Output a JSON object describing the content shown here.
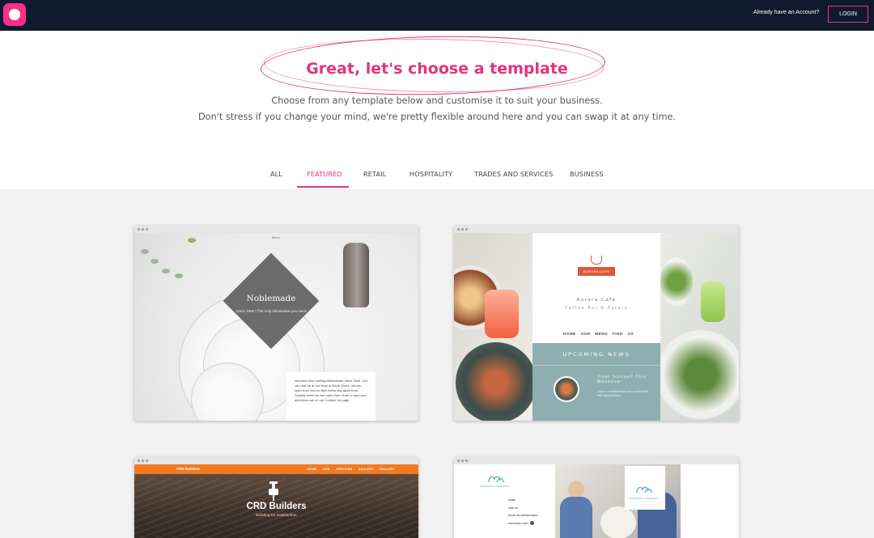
{
  "header": {
    "have_account": "Already have an Account?",
    "login_label": "LOGIN",
    "brand_color": "#ff2d8a",
    "bar_color": "#0f1a2e"
  },
  "hero": {
    "title": "Great, let's choose a template",
    "subtitle_1": "Choose from any template below and customise it to suit your business.",
    "subtitle_2": "Don't stress if you change your mind, we're pretty flexible around here and you can swap it at any time.",
    "accent_color": "#e4327f"
  },
  "tabs": [
    {
      "label": "ALL",
      "active": false
    },
    {
      "label": "FEATURED",
      "active": true
    },
    {
      "label": "RETAIL",
      "active": false
    },
    {
      "label": "HOSPITALITY",
      "active": false
    },
    {
      "label": "TRADES AND SERVICES",
      "active": false
    },
    {
      "label": "BUSINESS",
      "active": false
    }
  ],
  "templates": {
    "noblemade": {
      "top_note": "Menu",
      "brand": "Noblemade",
      "brand_sub": "Since 1965 | The only dinnerware you need",
      "about": "We have been selling kitchenware since 1965. You can visit us at our shop in North Shore, we are open from 9am to 5pm every day apart from Sunday when we are open from 11am to 4pm and directions are on our Contact Us page."
    },
    "aurora": {
      "ribbon": "AURORA CAFE",
      "name": "Aurora Cafe",
      "tagline": "Coffee Bar & Eatery",
      "nav": "HOME  OUR MENU  FIND US",
      "news_title": "UPCOMING NEWS",
      "news_heading": "Treat Yourself This Weekend!",
      "news_body": "Enjoy a complimentary hot or cold drink with any purchase."
    },
    "crd": {
      "nav_brand": "CRD Builders",
      "nav_links": "HOME  OUR SERVICES  GALLERY  GALLERY",
      "brand": "CRD Builders",
      "tagline": "Building for Satisfaction",
      "accent": "#f07b23"
    },
    "vet": {
      "logo_caption": "SEVEN OAKS VETERINARY",
      "menu_home": "HOME",
      "menu_find": "FIND US",
      "menu_book": "BOOK AN APPOINTMENT",
      "menu_cart": "SHOPPING CART",
      "accent": "#4aa8c7"
    }
  }
}
